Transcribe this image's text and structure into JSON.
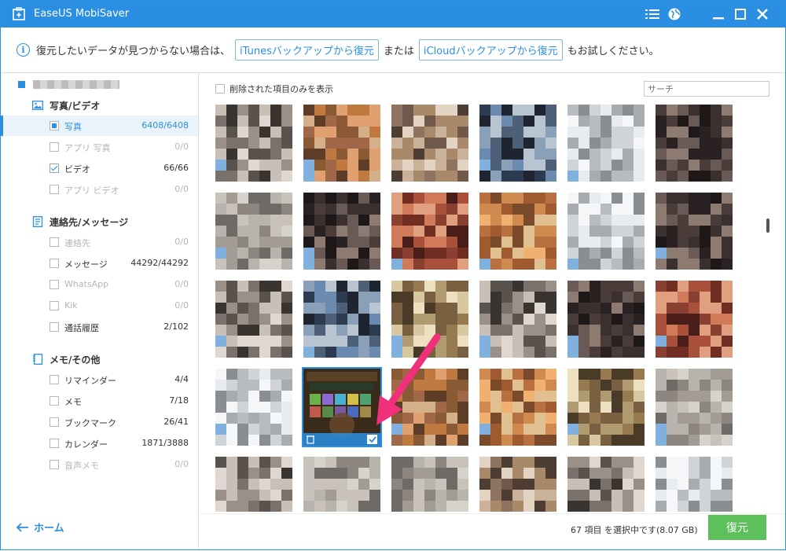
{
  "window": {
    "title": "EaseUS MobiSaver"
  },
  "info": {
    "text_before": "復元したいデータが見つからない場合は、",
    "link_itunes": "iTunesバックアップから復元",
    "text_middle": "または",
    "link_icloud": "iCloudバックアップから復元",
    "text_after": "もお試しください。"
  },
  "sidebar": {
    "sections": [
      {
        "title": "写真/ビデオ",
        "icon": "photo-icon"
      },
      {
        "title": "連絡先/メッセージ",
        "icon": "contacts-icon"
      },
      {
        "title": "メモ/その他",
        "icon": "notes-icon"
      }
    ],
    "items": [
      {
        "label": "写真",
        "count": "6408/6408",
        "state": "partial",
        "active": true,
        "disabled": false
      },
      {
        "label": "アプリ 写真",
        "count": "0/0",
        "state": "unchecked",
        "active": false,
        "disabled": true
      },
      {
        "label": "ビデオ",
        "count": "66/66",
        "state": "checked",
        "active": false,
        "disabled": false
      },
      {
        "label": "アプリ ビデオ",
        "count": "0/0",
        "state": "unchecked",
        "active": false,
        "disabled": true
      },
      {
        "label": "連絡先",
        "count": "0/0",
        "state": "unchecked",
        "active": false,
        "disabled": true
      },
      {
        "label": "メッセージ",
        "count": "44292/44292",
        "state": "unchecked",
        "active": false,
        "disabled": false
      },
      {
        "label": "WhatsApp",
        "count": "0/0",
        "state": "unchecked",
        "active": false,
        "disabled": true
      },
      {
        "label": "Kik",
        "count": "0/0",
        "state": "unchecked",
        "active": false,
        "disabled": true
      },
      {
        "label": "通話履歴",
        "count": "2/102",
        "state": "unchecked",
        "active": false,
        "disabled": false
      },
      {
        "label": "リマインダー",
        "count": "4/4",
        "state": "unchecked",
        "active": false,
        "disabled": false
      },
      {
        "label": "メモ",
        "count": "7/18",
        "state": "unchecked",
        "active": false,
        "disabled": false
      },
      {
        "label": "ブックマーク",
        "count": "26/41",
        "state": "unchecked",
        "active": false,
        "disabled": false
      },
      {
        "label": "カレンダー",
        "count": "1871/3888",
        "state": "unchecked",
        "active": false,
        "disabled": false
      },
      {
        "label": "音声メモ",
        "count": "0/0",
        "state": "unchecked",
        "active": false,
        "disabled": true
      }
    ],
    "home_label": "ホーム"
  },
  "main": {
    "filter_label": "削除された項目のみを表示",
    "search_placeholder": "サーチ"
  },
  "footer": {
    "status": "67 項目 を選択中です(8.07 GB)",
    "recover_label": "復元"
  },
  "colors": {
    "accent": "#2a8fe3",
    "recover": "#5cc15a",
    "arrow": "#f0307a"
  }
}
